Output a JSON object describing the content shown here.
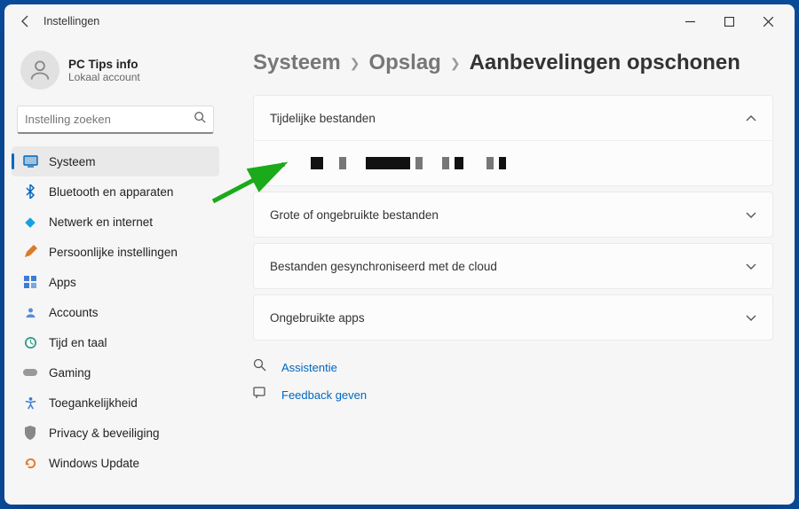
{
  "titlebar": {
    "title": "Instellingen"
  },
  "profile": {
    "name": "PC Tips info",
    "sub": "Lokaal account"
  },
  "search": {
    "placeholder": "Instelling zoeken"
  },
  "sidebar": {
    "items": [
      {
        "label": "Systeem"
      },
      {
        "label": "Bluetooth en apparaten"
      },
      {
        "label": "Netwerk en internet"
      },
      {
        "label": "Persoonlijke instellingen"
      },
      {
        "label": "Apps"
      },
      {
        "label": "Accounts"
      },
      {
        "label": "Tijd en taal"
      },
      {
        "label": "Gaming"
      },
      {
        "label": "Toegankelijkheid"
      },
      {
        "label": "Privacy & beveiliging"
      },
      {
        "label": "Windows Update"
      }
    ]
  },
  "breadcrumb": {
    "a": "Systeem",
    "b": "Opslag",
    "c": "Aanbevelingen opschonen"
  },
  "cards": [
    {
      "title": "Tijdelijke bestanden",
      "expanded": true
    },
    {
      "title": "Grote of ongebruikte bestanden",
      "expanded": false
    },
    {
      "title": "Bestanden gesynchroniseerd met de cloud",
      "expanded": false
    },
    {
      "title": "Ongebruikte apps",
      "expanded": false
    }
  ],
  "help": {
    "assistance": "Assistentie",
    "feedback": "Feedback geven"
  }
}
